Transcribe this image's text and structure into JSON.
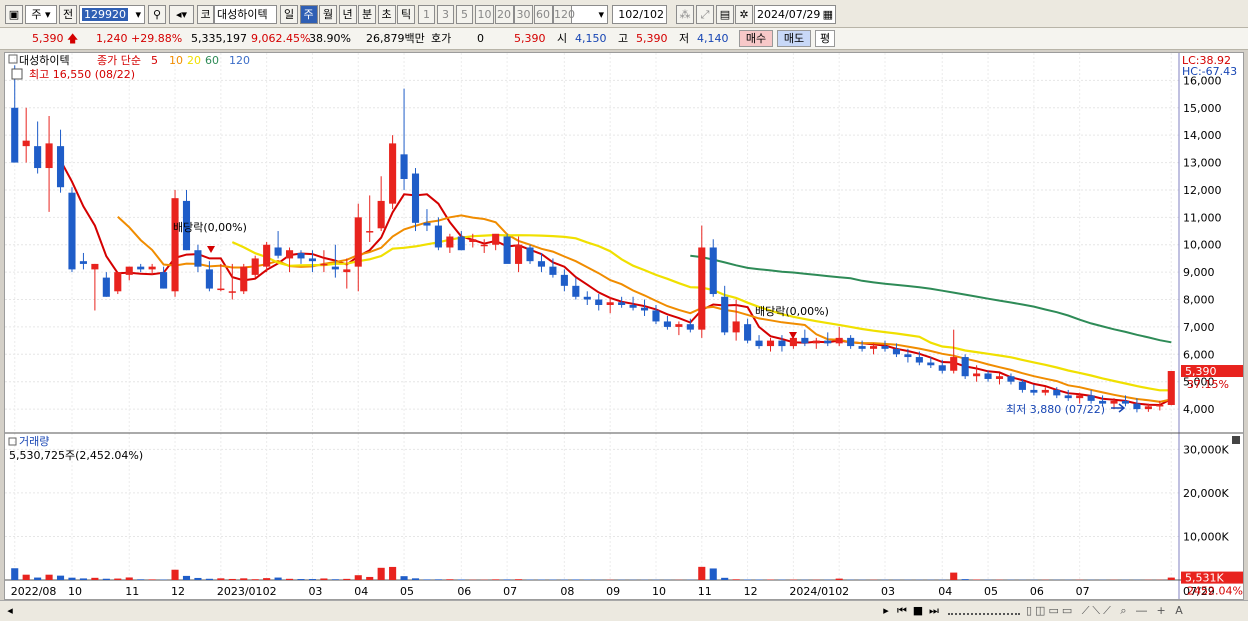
{
  "toolbar": {
    "market": "주",
    "jeon": "전",
    "code": "129920",
    "ko": "코",
    "name": "대성하이텍",
    "periods": [
      "일",
      "주",
      "월",
      "년",
      "분",
      "초",
      "틱"
    ],
    "active_period": "주",
    "numbers": [
      "1",
      "3",
      "5",
      "10",
      "20",
      "30",
      "60",
      "120"
    ],
    "count": "102",
    "total": "/102",
    "date": "2024/07/29"
  },
  "info": {
    "price": "5,390",
    "change": "1,240",
    "pct": "+29.88%",
    "volume": "5,335,197",
    "vol_pct": "9,062.45%",
    "turnover": "38.90%",
    "amount": "26,879백만",
    "hoga_label": "호가",
    "hoga": "0",
    "hoga_price": "5,390",
    "open_label": "시",
    "open": "4,150",
    "high_label": "고",
    "high": "5,390",
    "low_label": "저",
    "low": "4,140",
    "buy": "매수",
    "sell": "매도",
    "pyeong": "평"
  },
  "legend": {
    "name": "대성하이텍",
    "ma_label": "종가 단순",
    "ma_periods": [
      "5",
      "10",
      "20",
      "60",
      "120"
    ],
    "ma_colors": [
      "#d40000",
      "#f08c00",
      "#f0e000",
      "#2e8b57",
      "#3c6ec8"
    ],
    "max_note": "최고 16,550 (08/22)",
    "min_note": "최저 3,880 (07/22)",
    "div1": "배당락(0,00%)",
    "div2": "배당락(0,00%)"
  },
  "right": {
    "lc": "LC:38.92",
    "hc": "HC:-67.43",
    "last_price": "5,390",
    "last_pct": "37.15%",
    "last_vol": "5,531K",
    "last_vol_pct": "2452.04%"
  },
  "volume_panel": {
    "title": "거래량",
    "note": "5,530,725주(2,452.04%)"
  },
  "colors": {
    "up": "#e8231e",
    "down": "#1f5dc8"
  },
  "chart_data": {
    "type": "candlestick",
    "price_ticks": [
      4000,
      5000,
      6000,
      7000,
      8000,
      9000,
      10000,
      11000,
      12000,
      13000,
      14000,
      15000,
      16000
    ],
    "price_tick_labels": [
      "4,000",
      "5,000",
      "6,000",
      "7,000",
      "8,000",
      "9,000",
      "10,000",
      "11,000",
      "12,000",
      "13,000",
      "14,000",
      "15,000",
      "16,000"
    ],
    "volume_ticks": [
      10000,
      20000,
      30000
    ],
    "volume_tick_labels": [
      "10,000K",
      "20,000K",
      "30,000K"
    ],
    "x_labels": [
      "2022/08",
      "10",
      "11",
      "12",
      "2023/01",
      "02",
      "03",
      "04",
      "05",
      "06",
      "07",
      "08",
      "09",
      "10",
      "11",
      "12",
      "2024/01",
      "02",
      "03",
      "04",
      "05",
      "06",
      "07",
      "07/29"
    ],
    "x_label_index": [
      0,
      5,
      10,
      14,
      18,
      22,
      26,
      30,
      34,
      39,
      43,
      48,
      52,
      56,
      60,
      64,
      68,
      72,
      76,
      81,
      85,
      89,
      93,
      101
    ],
    "candles": [
      [
        15000,
        16550,
        13000,
        13000,
        2700
      ],
      [
        13600,
        15000,
        13000,
        13800,
        1220
      ],
      [
        13600,
        14500,
        12600,
        12800,
        560
      ],
      [
        12800,
        14700,
        11200,
        13700,
        1220
      ],
      [
        13600,
        14200,
        11900,
        12100,
        1000
      ],
      [
        11900,
        12100,
        9000,
        9100,
        530
      ],
      [
        9400,
        9700,
        9100,
        9300,
        360
      ],
      [
        9100,
        9300,
        7600,
        9300,
        500
      ],
      [
        8800,
        9000,
        8100,
        8100,
        290
      ],
      [
        8300,
        9000,
        8200,
        9000,
        330
      ],
      [
        8900,
        9200,
        8700,
        9200,
        580
      ],
      [
        9200,
        9300,
        9000,
        9100,
        160
      ],
      [
        9100,
        9300,
        8900,
        9200,
        140
      ],
      [
        9000,
        9200,
        8400,
        8400,
        100
      ],
      [
        8300,
        12000,
        8100,
        11700,
        2360
      ],
      [
        11600,
        12000,
        9800,
        9800,
        940
      ],
      [
        9800,
        10000,
        9000,
        9200,
        470
      ],
      [
        9100,
        9400,
        8300,
        8400,
        280
      ],
      [
        8400,
        9300,
        8300,
        8400,
        380
      ],
      [
        8300,
        9300,
        8000,
        8300,
        240
      ],
      [
        8300,
        9300,
        8200,
        9200,
        380
      ],
      [
        8900,
        9600,
        8800,
        9500,
        180
      ],
      [
        9200,
        10100,
        9000,
        10000,
        430
      ],
      [
        9900,
        10500,
        9500,
        9600,
        560
      ],
      [
        9500,
        9900,
        9000,
        9800,
        270
      ],
      [
        9700,
        9800,
        9300,
        9500,
        220
      ],
      [
        9500,
        9800,
        9000,
        9400,
        220
      ],
      [
        9300,
        9800,
        9000,
        9300,
        350
      ],
      [
        9200,
        10000,
        8800,
        9100,
        170
      ],
      [
        9000,
        9500,
        8400,
        9100,
        260
      ],
      [
        9200,
        11500,
        8300,
        11000,
        1100
      ],
      [
        10500,
        11800,
        10100,
        10500,
        700
      ],
      [
        10600,
        12500,
        10500,
        11600,
        2800
      ],
      [
        11500,
        14000,
        11300,
        13700,
        3000
      ],
      [
        13300,
        15700,
        12000,
        12400,
        880
      ],
      [
        12600,
        12800,
        10500,
        10800,
        380
      ],
      [
        10800,
        11300,
        10500,
        10700,
        130
      ],
      [
        10700,
        11000,
        9800,
        9900,
        150
      ],
      [
        9900,
        10400,
        9700,
        10300,
        170
      ],
      [
        10300,
        10500,
        9800,
        9800,
        120
      ],
      [
        10100,
        10400,
        9900,
        10200,
        60
      ],
      [
        10000,
        10200,
        9700,
        10000,
        70
      ],
      [
        10000,
        10300,
        9800,
        10400,
        150
      ],
      [
        10300,
        10400,
        9400,
        9300,
        130
      ],
      [
        9300,
        10300,
        9000,
        10000,
        180
      ],
      [
        9900,
        10000,
        9300,
        9400,
        90
      ],
      [
        9400,
        9700,
        9000,
        9200,
        100
      ],
      [
        9200,
        9500,
        8800,
        8900,
        100
      ],
      [
        8900,
        9100,
        8300,
        8500,
        90
      ],
      [
        8500,
        8800,
        8000,
        8100,
        120
      ],
      [
        8100,
        8300,
        7800,
        8000,
        100
      ],
      [
        8000,
        8200,
        7600,
        7800,
        70
      ],
      [
        7800,
        8100,
        7500,
        7900,
        60
      ],
      [
        7900,
        8100,
        7700,
        7800,
        60
      ],
      [
        7800,
        8100,
        7600,
        7700,
        60
      ],
      [
        7700,
        8000,
        7400,
        7600,
        60
      ],
      [
        7600,
        7800,
        7100,
        7200,
        60
      ],
      [
        7200,
        7400,
        6900,
        7000,
        50
      ],
      [
        7000,
        7200,
        6700,
        7100,
        50
      ],
      [
        7100,
        7300,
        6800,
        6900,
        60
      ],
      [
        6900,
        10700,
        6600,
        9900,
        3020
      ],
      [
        9900,
        10200,
        8100,
        8200,
        2650
      ],
      [
        8100,
        8500,
        6700,
        6800,
        500
      ],
      [
        6800,
        8000,
        6500,
        7200,
        160
      ],
      [
        7100,
        7300,
        6400,
        6500,
        110
      ],
      [
        6500,
        6700,
        6200,
        6300,
        100
      ],
      [
        6300,
        6600,
        6100,
        6500,
        100
      ],
      [
        6500,
        6700,
        6100,
        6300,
        90
      ],
      [
        6300,
        6800,
        6200,
        6600,
        90
      ],
      [
        6600,
        6900,
        6300,
        6400,
        60
      ],
      [
        6400,
        6600,
        6200,
        6500,
        60
      ],
      [
        6500,
        6800,
        6300,
        6400,
        70
      ],
      [
        6400,
        7000,
        6300,
        6600,
        320
      ],
      [
        6600,
        6700,
        6200,
        6300,
        70
      ],
      [
        6300,
        6500,
        6100,
        6200,
        60
      ],
      [
        6200,
        6400,
        6000,
        6300,
        60
      ],
      [
        6300,
        6500,
        6100,
        6200,
        60
      ],
      [
        6200,
        6400,
        5900,
        6000,
        60
      ],
      [
        6000,
        6200,
        5700,
        5900,
        60
      ],
      [
        5900,
        6100,
        5600,
        5700,
        60
      ],
      [
        5700,
        5900,
        5500,
        5600,
        60
      ],
      [
        5600,
        5800,
        5300,
        5400,
        60
      ],
      [
        5400,
        6900,
        5300,
        5900,
        1700
      ],
      [
        5900,
        6000,
        5100,
        5200,
        200
      ],
      [
        5200,
        5600,
        5000,
        5300,
        100
      ],
      [
        5300,
        5400,
        5000,
        5100,
        60
      ],
      [
        5100,
        5300,
        4900,
        5200,
        60
      ],
      [
        5200,
        5300,
        4900,
        5000,
        60
      ],
      [
        5000,
        5100,
        4600,
        4700,
        50
      ],
      [
        4700,
        4900,
        4500,
        4600,
        50
      ],
      [
        4600,
        4800,
        4500,
        4700,
        50
      ],
      [
        4700,
        4800,
        4400,
        4500,
        50
      ],
      [
        4500,
        4700,
        4300,
        4400,
        50
      ],
      [
        4400,
        4600,
        4200,
        4500,
        50
      ],
      [
        4500,
        4700,
        4200,
        4300,
        50
      ],
      [
        4300,
        4500,
        4100,
        4200,
        50
      ],
      [
        4200,
        4400,
        4000,
        4300,
        50
      ],
      [
        4300,
        4500,
        4100,
        4200,
        50
      ],
      [
        4200,
        4400,
        3880,
        4000,
        50
      ],
      [
        4000,
        4200,
        3900,
        4100,
        50
      ],
      [
        4100,
        4300,
        3950,
        4150,
        50
      ],
      [
        4150,
        5390,
        4140,
        5390,
        553
      ]
    ],
    "ma_60_start": 60,
    "ma_120_visible": false
  }
}
